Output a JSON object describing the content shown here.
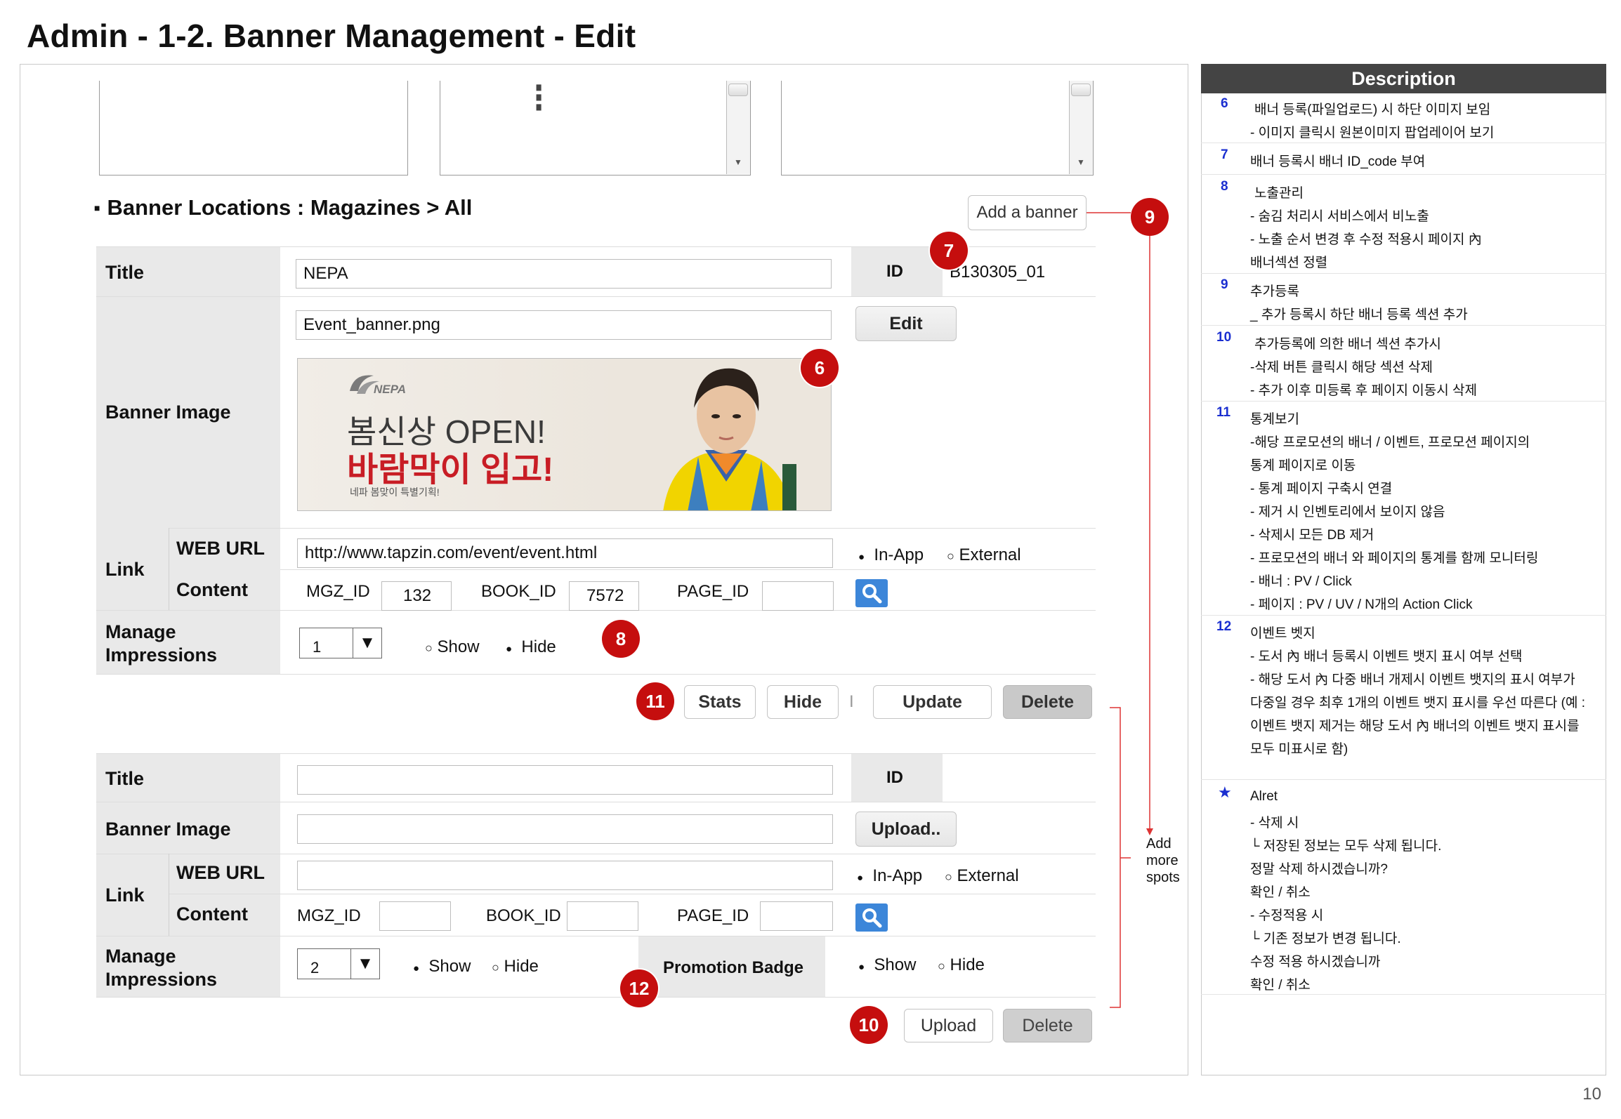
{
  "page": {
    "title": "Admin - 1-2. Banner Management - Edit",
    "page_number": "10"
  },
  "section": {
    "title": "Banner Locations : Magazines > All",
    "add_banner_label": "Add a banner"
  },
  "banner1": {
    "title_label": "Title",
    "title_value": "NEPA",
    "id_label": "ID",
    "id_value": "B130305_01",
    "image_label": "Banner Image",
    "image_file": "Event_banner.png",
    "edit_label": "Edit",
    "image_brand": "NEPA",
    "image_line1": "봄신상 OPEN!",
    "image_line2": "바람막이 입고!",
    "image_line3": "네파 봄맞이 특별기획!",
    "link_label": "Link",
    "web_url_label": "WEB URL",
    "web_url_value": "http://www.tapzin.com/event/event.html",
    "in_app_label": "In-App",
    "external_label": "External",
    "content_label": "Content",
    "mgz_id_label": "MGZ_ID",
    "mgz_id_value": "132",
    "book_id_label": "BOOK_ID",
    "book_id_value": "7572",
    "page_id_label": "PAGE_ID",
    "page_id_value": "",
    "manage_label_1": "Manage",
    "manage_label_2": "Impressions",
    "order_value": "1",
    "show_label": "Show",
    "hide_label": "Hide",
    "stats_label": "Stats",
    "hide_button_label": "Hide",
    "divider": "I",
    "update_label": "Update",
    "delete_label": "Delete"
  },
  "banner2": {
    "title_label": "Title",
    "title_value": "",
    "id_label": "ID",
    "image_label": "Banner Image",
    "upload_file_label": "Upload..",
    "link_label": "Link",
    "web_url_label": "WEB URL",
    "in_app_label": "In-App",
    "external_label": "External",
    "content_label": "Content",
    "mgz_id_label": "MGZ_ID",
    "book_id_label": "BOOK_ID",
    "page_id_label": "PAGE_ID",
    "manage_label_1": "Manage",
    "manage_label_2": "Impressions",
    "order_value": "2",
    "show_label": "Show",
    "hide_label": "Hide",
    "promotion_badge_label": "Promotion Badge",
    "badge_show_label": "Show",
    "badge_hide_label": "Hide",
    "upload_label": "Upload",
    "delete_label": "Delete"
  },
  "markers": {
    "m6": "6",
    "m7": "7",
    "m8": "8",
    "m9": "9",
    "m10": "10",
    "m11": "11",
    "m12": "12"
  },
  "side_note": {
    "line1": "Add",
    "line2": "more",
    "line3": "spots"
  },
  "radio_glyphs": {
    "filled": "●",
    "empty": "○"
  },
  "icons": {
    "dropdown_arrow": "▼",
    "scroll_down": "▼",
    "kebab": "⋮",
    "star": "★"
  },
  "description": {
    "header": "Description",
    "items": [
      {
        "num": "6",
        "lines": [
          "배너 등록(파일업로드) 시 하단 이미지 보임",
          "- 이미지 클릭시 원본이미지 팝업레이어 보기"
        ]
      },
      {
        "num": "7",
        "lines": [
          "배너 등록시 배너 ID_code 부여"
        ]
      },
      {
        "num": "8",
        "lines": [
          "노출관리",
          "- 숨김 처리시 서비스에서 비노출",
          "-  노출 순서 변경 후 수정 적용시 페이지 內",
          "   배너섹션 정렬"
        ]
      },
      {
        "num": "9",
        "lines": [
          "추가등록",
          "_ 추가 등록시 하단 배너 등록 섹션 추가"
        ]
      },
      {
        "num": "10",
        "lines": [
          "추가등록에 의한 배너 섹션 추가시",
          "-삭제 버튼 클릭시 해당 섹션 삭제",
          "- 추가 이후 미등록 후 페이지 이동시 삭제"
        ]
      },
      {
        "num": "11",
        "lines": [
          "통계보기",
          "-해당 프로모션의 배너 / 이벤트, 프로모션 페이지의",
          "   통계 페이지로 이동",
          "-  통계 페이지 구축시 연결",
          "-  제거 시 인벤토리에서 보이지 않음",
          "-  삭제시 모든 DB 제거",
          "- 프로모션의 배너 와 페이지의 통계를 함께 모니터링",
          "- 배너 : PV / Click",
          "- 페이지 : PV / UV / N개의 Action Click"
        ]
      },
      {
        "num": "12",
        "lines": [
          "이벤트 벳지",
          "- 도서 內 배너 등록시 이벤트 뱃지 표시 여부 선택",
          "- 해당 도서 內 다중 배너 개제시 이벤트 뱃지의 표시 여부가",
          "다중일 경우 최후 1개의 이벤트 뱃지 표시를 우선 따른다 (예 :",
          "이벤트 뱃지 제거는 해당 도서 內 배너의 이벤트 뱃지 표시를",
          "모두 미표시로 함)"
        ]
      },
      {
        "num": "★",
        "lines": [
          "Alret",
          "- 삭제 시",
          "   └ 저장된 정보는 모두 삭제 됩니다.",
          "      정말 삭제 하시겠습니까?",
          "      확인 / 취소",
          "- 수정적용 시",
          "     └ 기존 정보가 변경 됩니다.",
          "       수정 적용 하시겠습니까",
          "       확인 / 취소"
        ]
      }
    ]
  }
}
